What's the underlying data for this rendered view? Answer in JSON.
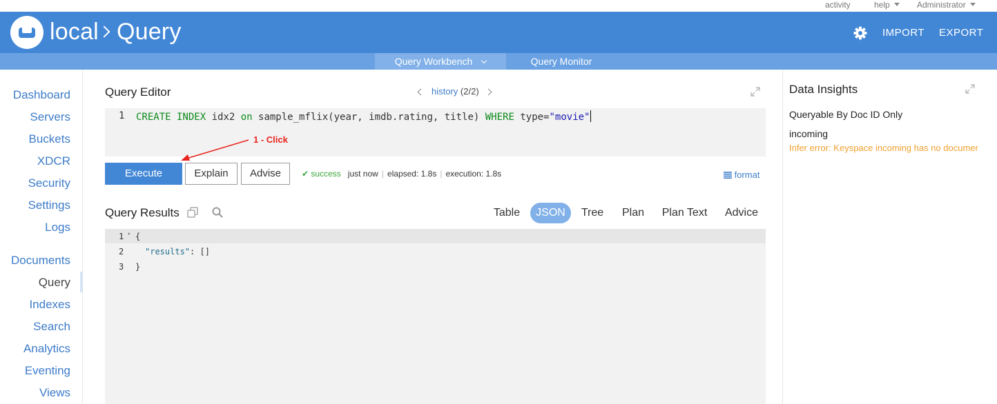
{
  "top": {
    "activity": "activity",
    "help": "help",
    "user": "Administrator"
  },
  "header": {
    "cluster": "local",
    "page": "Query",
    "import": "IMPORT",
    "export": "EXPORT"
  },
  "subnav": {
    "workbench": "Query Workbench",
    "monitor": "Query Monitor"
  },
  "sidebar": {
    "items": [
      "Dashboard",
      "Servers",
      "Buckets",
      "XDCR",
      "Security",
      "Settings",
      "Logs",
      "Documents",
      "Query",
      "Indexes",
      "Search",
      "Analytics",
      "Eventing",
      "Views"
    ],
    "current": "Query"
  },
  "editor": {
    "title": "Query Editor",
    "history_label": "history",
    "history_count": "(2/2)",
    "line_number": "1",
    "code": {
      "k1": "CREATE INDEX",
      "p1": " idx2 ",
      "k2": "on",
      "p2": " sample_mflix(year, imdb.rating, title) ",
      "k3": "WHERE",
      "p3": " type=",
      "s1": "\"movie\""
    }
  },
  "annotation": "1 - Click",
  "actions": {
    "execute": "Execute",
    "explain": "Explain",
    "advise": "Advise",
    "format": "format"
  },
  "status": {
    "result": "success",
    "when": "just now",
    "elapsed": "elapsed: 1.8s",
    "execution": "execution: 1.8s"
  },
  "results": {
    "title": "Query Results",
    "tabs": [
      "Table",
      "JSON",
      "Tree",
      "Plan",
      "Plan Text",
      "Advice"
    ],
    "active_tab": "JSON",
    "lines": [
      {
        "n": "1",
        "text": "{"
      },
      {
        "n": "2",
        "key": "\"results\"",
        "text": ": []"
      },
      {
        "n": "3",
        "text": "}"
      }
    ]
  },
  "insights": {
    "title": "Data Insights",
    "doc_id": "Queryable By Doc ID Only",
    "keyspace": "incoming",
    "error": "Infer error: Keyspace incoming has no documer"
  },
  "colors": {
    "brand": "#4287d6",
    "subnav": "#6aa1e2",
    "link": "#3d7cc9",
    "success": "#3aa53a",
    "warning": "#f0a02e",
    "annotation": "#e8241d"
  }
}
